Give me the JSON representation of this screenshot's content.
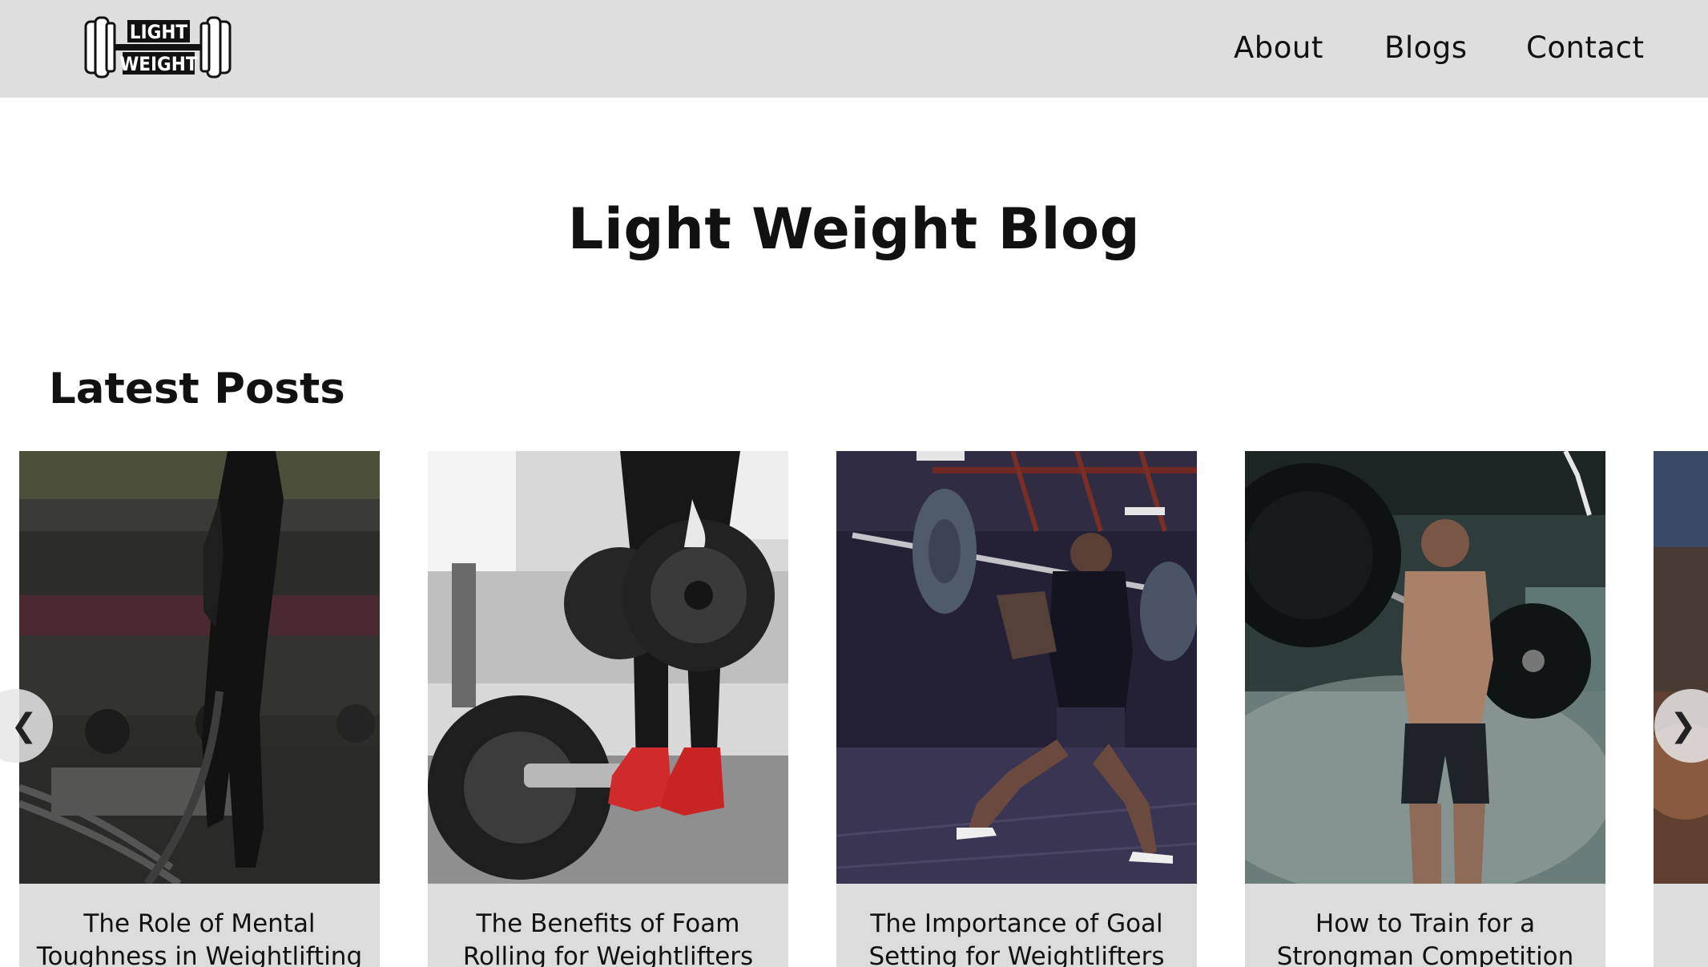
{
  "header": {
    "logo_top": "LIGHT",
    "logo_bottom": "WEIGHT",
    "nav": [
      {
        "label": "About"
      },
      {
        "label": "Blogs"
      },
      {
        "label": "Contact"
      }
    ]
  },
  "main": {
    "title": "Light Weight Blog",
    "section_title": "Latest Posts"
  },
  "carousel": {
    "prev_glyph": "❮",
    "next_glyph": "❯",
    "posts": [
      {
        "title": "The Role of Mental Toughness in Weightlifting",
        "image": "woman-battle-ropes-gym"
      },
      {
        "title": "The Benefits of Foam Rolling for Weightlifters",
        "image": "weight-plates-red-sneakers"
      },
      {
        "title": "The Importance of Goal Setting for Weightlifters",
        "image": "man-barbell-lunge"
      },
      {
        "title": "How to Train for a Strongman Competition",
        "image": "man-barbell-squat-smoke"
      },
      {
        "title": "",
        "image": "partial-next-card"
      }
    ]
  },
  "colors": {
    "navbar_bg": "#dedede",
    "card_bg": "#dcdcdc",
    "text": "#111111"
  }
}
